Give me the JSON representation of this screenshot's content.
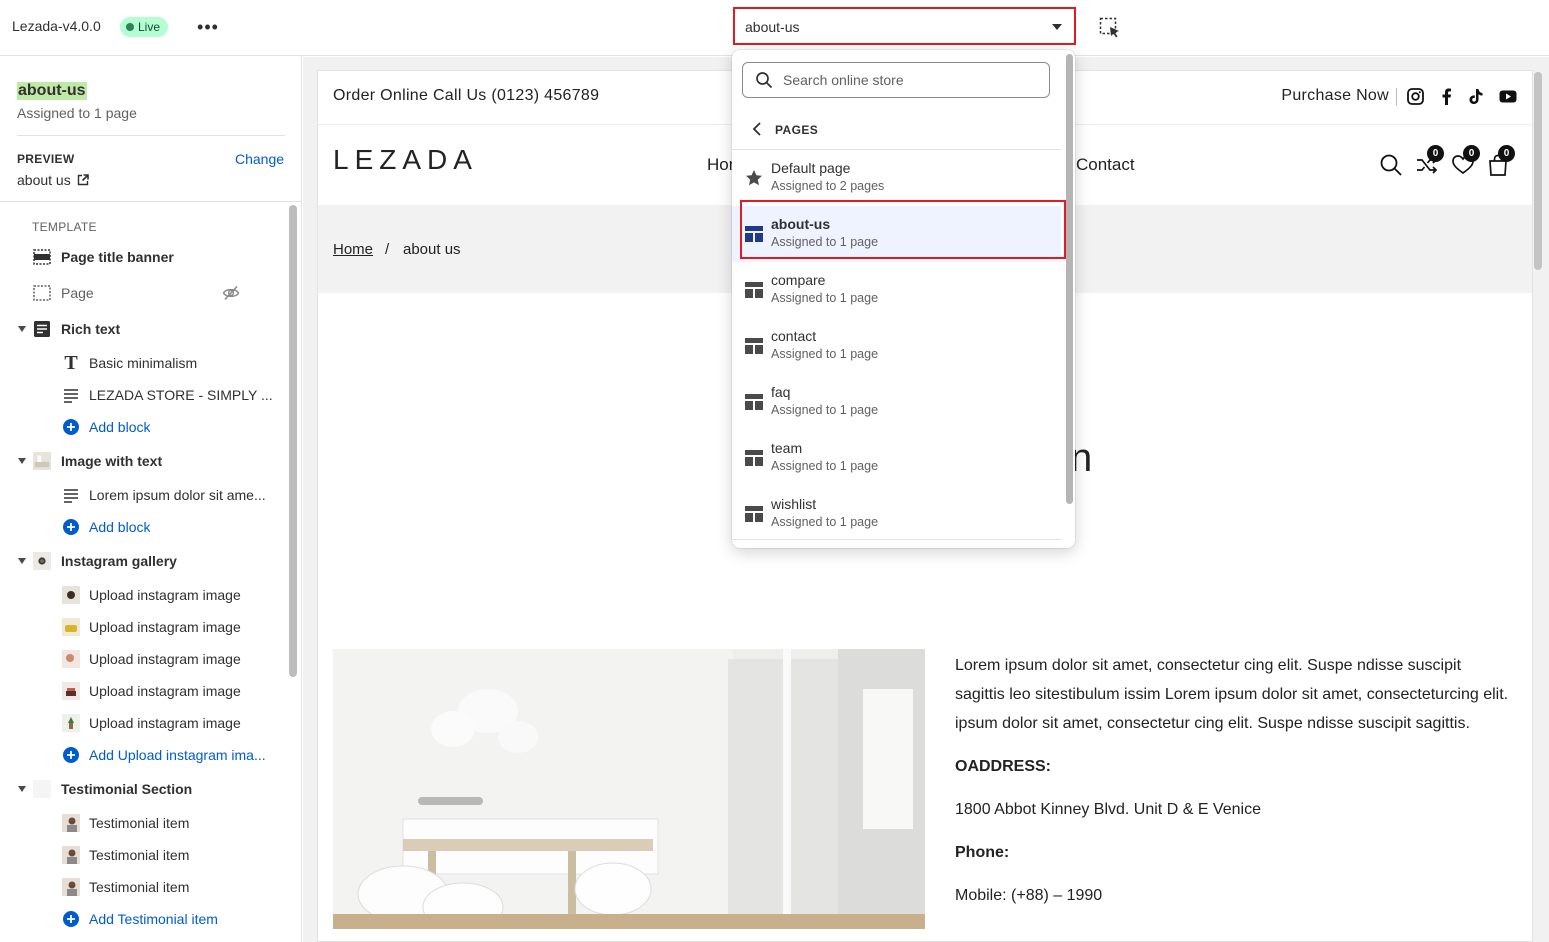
{
  "topbar": {
    "app_title": "Lezada-v4.0.0",
    "status_badge": "Live",
    "more_label": "•••",
    "template_select_value": "about-us"
  },
  "sidebar": {
    "title": "about-us",
    "subtitle": "Assigned to 1 page",
    "preview_label": "PREVIEW",
    "change_label": "Change",
    "preview_value": "about us",
    "template_label": "TEMPLATE",
    "items": [
      {
        "label": "Page title banner",
        "icon": "section-icon"
      },
      {
        "label": "Page",
        "icon": "section-icon"
      },
      {
        "label": "Rich text",
        "icon": "rich-text-icon"
      },
      {
        "label": "Basic minimalism",
        "icon": "text-icon"
      },
      {
        "label": "LEZADA STORE - SIMPLY ...",
        "icon": "paragraph-icon"
      },
      {
        "label": "Add block",
        "icon": "plus-circle-icon"
      },
      {
        "label": "Image with text",
        "icon": "image-thumb"
      },
      {
        "label": "Lorem ipsum dolor sit ame...",
        "icon": "paragraph-icon"
      },
      {
        "label": "Add block",
        "icon": "plus-circle-icon"
      },
      {
        "label": "Instagram gallery",
        "icon": "image-thumb"
      },
      {
        "label": "Upload instagram image",
        "icon": "image-thumb"
      },
      {
        "label": "Upload instagram image",
        "icon": "image-thumb"
      },
      {
        "label": "Upload instagram image",
        "icon": "image-thumb"
      },
      {
        "label": "Upload instagram image",
        "icon": "image-thumb"
      },
      {
        "label": "Upload instagram image",
        "icon": "image-thumb"
      },
      {
        "label": "Add Upload instagram ima...",
        "icon": "plus-circle-icon"
      },
      {
        "label": "Testimonial Section",
        "icon": "blank-thumb"
      },
      {
        "label": "Testimonial item",
        "icon": "portrait-thumb"
      },
      {
        "label": "Testimonial item",
        "icon": "portrait-thumb"
      },
      {
        "label": "Testimonial item",
        "icon": "portrait-thumb"
      },
      {
        "label": "Add Testimonial item",
        "icon": "plus-circle-icon"
      }
    ]
  },
  "dropdown": {
    "search_placeholder": "Search online store",
    "section_label": "PAGES",
    "items": [
      {
        "name": "Default page",
        "meta": "Assigned to 2 pages",
        "icon": "star-icon"
      },
      {
        "name": "about-us",
        "meta": "Assigned to 1 page",
        "icon": "layout-icon",
        "selected": true
      },
      {
        "name": "compare",
        "meta": "Assigned to 1 page",
        "icon": "layout-icon"
      },
      {
        "name": "contact",
        "meta": "Assigned to 1 page",
        "icon": "layout-icon"
      },
      {
        "name": "faq",
        "meta": "Assigned to 1 page",
        "icon": "layout-icon"
      },
      {
        "name": "team",
        "meta": "Assigned to 1 page",
        "icon": "layout-icon"
      },
      {
        "name": "wishlist",
        "meta": "Assigned to 1 page",
        "icon": "layout-icon"
      }
    ]
  },
  "store": {
    "announcement": "Order Online Call Us (0123) 456789",
    "purchase_now": "Purchase Now",
    "logo": "LEZADA",
    "nav": [
      "Hom",
      "Contact"
    ],
    "counts": {
      "compare": "0",
      "wishlist": "0",
      "cart": "0"
    },
    "breadcrumb_home": "Home",
    "breadcrumb_sep": "/",
    "breadcrumb_current": "about us",
    "heading_fragment": "n",
    "paragraph": "Lorem ipsum dolor sit amet, consectetur cing elit. Suspe ndisse suscipit sagittis leo sitestibulum issim Lorem ipsum dolor sit amet, consecteturcing elit. ipsum dolor sit amet, consectetur cing elit. Suspe ndisse suscipit sagittis.",
    "address_heading": "OADDRESS:",
    "address": "1800 Abbot Kinney Blvd. Unit D & E Venice",
    "phone_heading": "Phone:",
    "mobile": "Mobile: (+88) – 1990"
  },
  "colors": {
    "accent_link": "#005bd3",
    "highlight_red": "#e01b24",
    "live_badge_bg": "#b4fed2",
    "selected_row_bg": "#eef3ff"
  }
}
